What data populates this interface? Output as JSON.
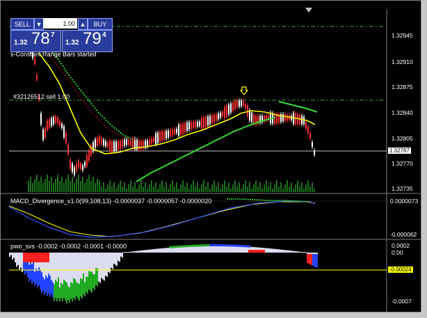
{
  "trade_panel": {
    "sell_label": "SELL",
    "buy_label": "BUY",
    "lot_value": "1.00",
    "sell_price_prefix": "1.32",
    "sell_price_big": "78",
    "sell_price_sup": "7",
    "buy_price_prefix": "1.32",
    "buy_price_big": "79",
    "buy_price_sup": "4"
  },
  "main_chart": {
    "status_text": "s-Constant Range Bars started",
    "order_line_label": "#32126512 sell 1.00",
    "current_price": "1.32787",
    "price_axis": [
      "1.32945",
      "1.32910",
      "1.32875",
      "1.32840",
      "1.32805",
      "1.32770",
      "1.32735"
    ]
  },
  "macd_pane": {
    "title": "MACD_Divergence_v1.0(99,108,13) -0.0000037 -0.0000057 -0.0000020",
    "axis_top": "0.0000073",
    "axis_bottom": "-0.000062"
  },
  "pwo_pane": {
    "title": "pwo_svs -0.0002 -0.0002 -0.0001 -0.0000",
    "axis_top": "0.0002",
    "axis_mid": "0.00",
    "current_value": "-0.00024",
    "axis_bottom": "-0.0007"
  },
  "colors": {
    "background": "#000000",
    "candle": "#ffffff",
    "candle_red": "#ff3030",
    "ma_yellow": "#ffff00",
    "ma_green": "#33dd33",
    "panel_blue": "#2a3d9c"
  },
  "icons": {
    "arrow_marker": "down-arrow-icon",
    "scroll_marker": "triangle-down-icon"
  }
}
